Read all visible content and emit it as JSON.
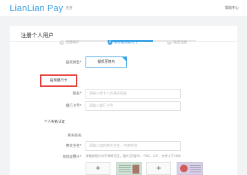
{
  "header": {
    "logo": "LianLian Pay",
    "logo_sub": "连连",
    "help": "帮助中心"
  },
  "page": {
    "title": "注册个人用户"
  },
  "steps": [
    {
      "num": "1",
      "label": "创建用户"
    },
    {
      "num": "2",
      "label": "绑定提现银行卡"
    },
    {
      "num": "3",
      "label": "完成注册"
    }
  ],
  "withdraw_type": {
    "label": "提现类型",
    "option": "提现至境内"
  },
  "section": {
    "bank_card_title": "提现银行卡"
  },
  "fields": {
    "name_label": "姓名",
    "name_placeholder": "请输入持卡人的真实姓名",
    "card_label": "银行卡号",
    "card_placeholder": "请输入银行卡号"
  },
  "verification": {
    "title": "个人实名认证",
    "real_name_label": "真实姓名",
    "english_name_label": "英文全名",
    "english_name_placeholder": "请输入您的英文全名，可用拼音",
    "id_photo_label": "身份证照片",
    "id_hint": "请确保照片文字清晰可见，图片支持JPG、PNG、GIF，文件小于2MB",
    "upload_plus": "+"
  }
}
